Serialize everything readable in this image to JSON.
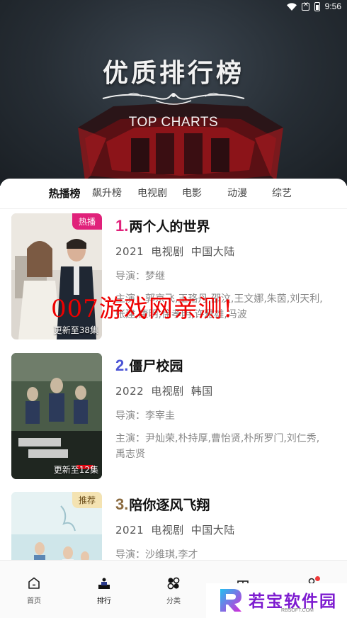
{
  "status_bar": {
    "time": "9:56"
  },
  "hero": {
    "title": "优质排行榜",
    "subtitle": "TOP CHARTS"
  },
  "tabs": [
    {
      "label": "热播榜",
      "active": true
    },
    {
      "label": "飙升榜",
      "active": false
    },
    {
      "label": "电视剧",
      "active": false
    },
    {
      "label": "电影",
      "active": false
    },
    {
      "label": "动漫",
      "active": false
    },
    {
      "label": "综艺",
      "active": false
    }
  ],
  "items": [
    {
      "rank": "1.",
      "rank_color": "#e0217a",
      "title": "两个人的世界",
      "year": "2021",
      "category": "电视剧",
      "region": "中国大陆",
      "director": "导演：梦继",
      "cast": "主演：郭京飞,王珞丹,邵汶,王文娜,朱茵,刘天利,张建,康明,徐孝明,许雅雄,冯波",
      "badge": "热播",
      "episode": "更新至38集"
    },
    {
      "rank": "2.",
      "rank_color": "#4b54d6",
      "title": "僵尸校园",
      "year": "2022",
      "category": "电视剧",
      "region": "韩国",
      "director": "导演：李宰圭",
      "cast": "主演：尹灿荣,朴持厚,曹怡贤,朴所罗门,刘仁秀,禹志贤",
      "badge": "",
      "episode": "更新至12集"
    },
    {
      "rank": "3.",
      "rank_color": "#8a6a3f",
      "title": "陪你逐风飞翔",
      "year": "2021",
      "category": "电视剧",
      "region": "中国大陆",
      "director": "导演：沙维琪,李才",
      "cast": "",
      "badge": "推荐",
      "episode": ""
    }
  ],
  "watermark": "007游戏网亲测!",
  "bottom_nav": [
    {
      "label": "首页",
      "icon": "home-icon"
    },
    {
      "label": "排行",
      "icon": "ranking-icon"
    },
    {
      "label": "分类",
      "icon": "category-icon"
    },
    {
      "label": "",
      "icon": "gift-icon"
    },
    {
      "label": "",
      "icon": "profile-icon"
    }
  ],
  "logo_watermark": {
    "text": "若宝软件园",
    "sub": "RBSOFT.COM"
  }
}
